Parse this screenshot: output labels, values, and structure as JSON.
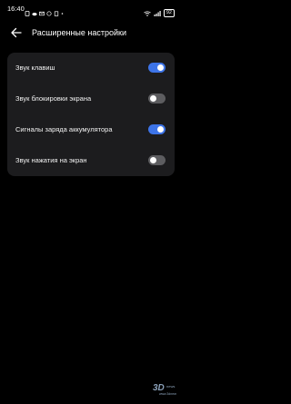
{
  "status_bar": {
    "time": "16:40",
    "battery": "92",
    "icons": [
      "sim-icon",
      "cloud-icon",
      "mail-icon",
      "sync-icon",
      "clipboard-icon",
      "dot-icon",
      "wifi-icon",
      "signal-icon",
      "battery-icon"
    ]
  },
  "header": {
    "title": "Расширенные настройки"
  },
  "settings": [
    {
      "label": "Звук клавиш",
      "enabled": true
    },
    {
      "label": "Звук блокировки экрана",
      "enabled": false
    },
    {
      "label": "Сигналы заряда аккумулятора",
      "enabled": true
    },
    {
      "label": "Звук нажатия на экран",
      "enabled": false
    }
  ],
  "colors": {
    "accent": "#3d74e8",
    "card": "#1c1c1e",
    "background": "#000000"
  }
}
